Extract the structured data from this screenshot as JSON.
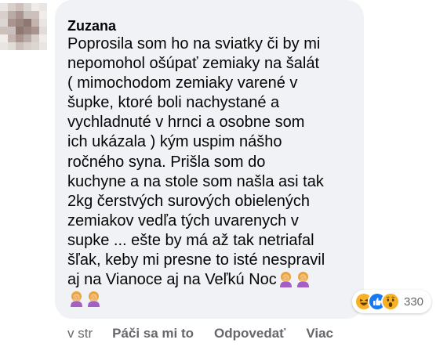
{
  "comment": {
    "author": "Zuzana",
    "text_lines": [
      "Poprosila som ho na sviatky či by mi",
      "nepomohol ošúpať zemiaky na šalát",
      "( mimochodom zemiaky varené v",
      "šupke, ktoré boli nachystané a",
      "vychladnuté v hrnci a osobne som",
      "ich ukázala ) kým uspim nášho",
      "ročného syna. Prišla som do",
      "kuchyne a na stole som našla asi tak",
      "2kg čerstvých surových obielených",
      "zemiakov vedľa tých uvarenych v",
      "supke ... ešte by má až tak netriafal",
      "šľak, keby mi presne to isté nespravil",
      "aj na Vianoce aj na Veľkú Noc"
    ],
    "trailing_emoji": "woman-facepalming-icon"
  },
  "reactions": {
    "icons": [
      "laughing-reaction-icon",
      "like-reaction-icon",
      "wow-reaction-icon"
    ],
    "count": "330"
  },
  "actions": {
    "timestamp": "v str",
    "like_label": "Páči sa mi to",
    "reply_label": "Odpovedať",
    "more_label": "Viac"
  },
  "colors": {
    "bubble": "#f0f2f5",
    "text": "#050505",
    "secondary_text": "#65676b",
    "like_blue": "#1877f2",
    "reaction_yellow": "#f7b125"
  }
}
